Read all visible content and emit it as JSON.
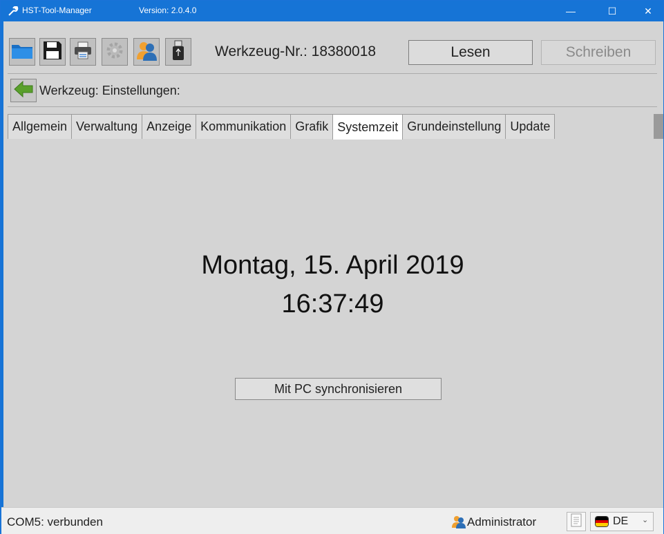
{
  "window": {
    "title": "HST-Tool-Manager",
    "version": "Version: 2.0.4.0",
    "controls": {
      "minimize": "—",
      "maximize": "☐",
      "close": "✕"
    }
  },
  "toolbar": {
    "icons": [
      "open-folder-icon",
      "save-icon",
      "print-icon",
      "settings-gear-icon",
      "users-icon",
      "usb-stick-icon"
    ],
    "tool_number": "Werkzeug-Nr.: 18380018",
    "read_label": "Lesen",
    "write_label": "Schreiben"
  },
  "breadcrumb": {
    "label": "Werkzeug: Einstellungen:"
  },
  "tabs": [
    {
      "label": "Allgemein",
      "active": false
    },
    {
      "label": "Verwaltung",
      "active": false
    },
    {
      "label": "Anzeige",
      "active": false
    },
    {
      "label": "Kommunikation",
      "active": false
    },
    {
      "label": "Grafik",
      "active": false
    },
    {
      "label": "Systemzeit",
      "active": true
    },
    {
      "label": "Grundeinstellung",
      "active": false
    },
    {
      "label": "Update",
      "active": false
    }
  ],
  "systemtime": {
    "date": "Montag, 15. April 2019",
    "time": "16:37:49",
    "sync_label": "Mit PC synchronisieren"
  },
  "statusbar": {
    "connection": "COM5: verbunden",
    "user": "Administrator",
    "language": "DE"
  },
  "colors": {
    "titlebar": "#1674d6",
    "background": "#d4d4d4",
    "arrow_green": "#5aa02c",
    "flag_black": "#000000",
    "flag_red": "#dd0000",
    "flag_gold": "#ffce00"
  }
}
